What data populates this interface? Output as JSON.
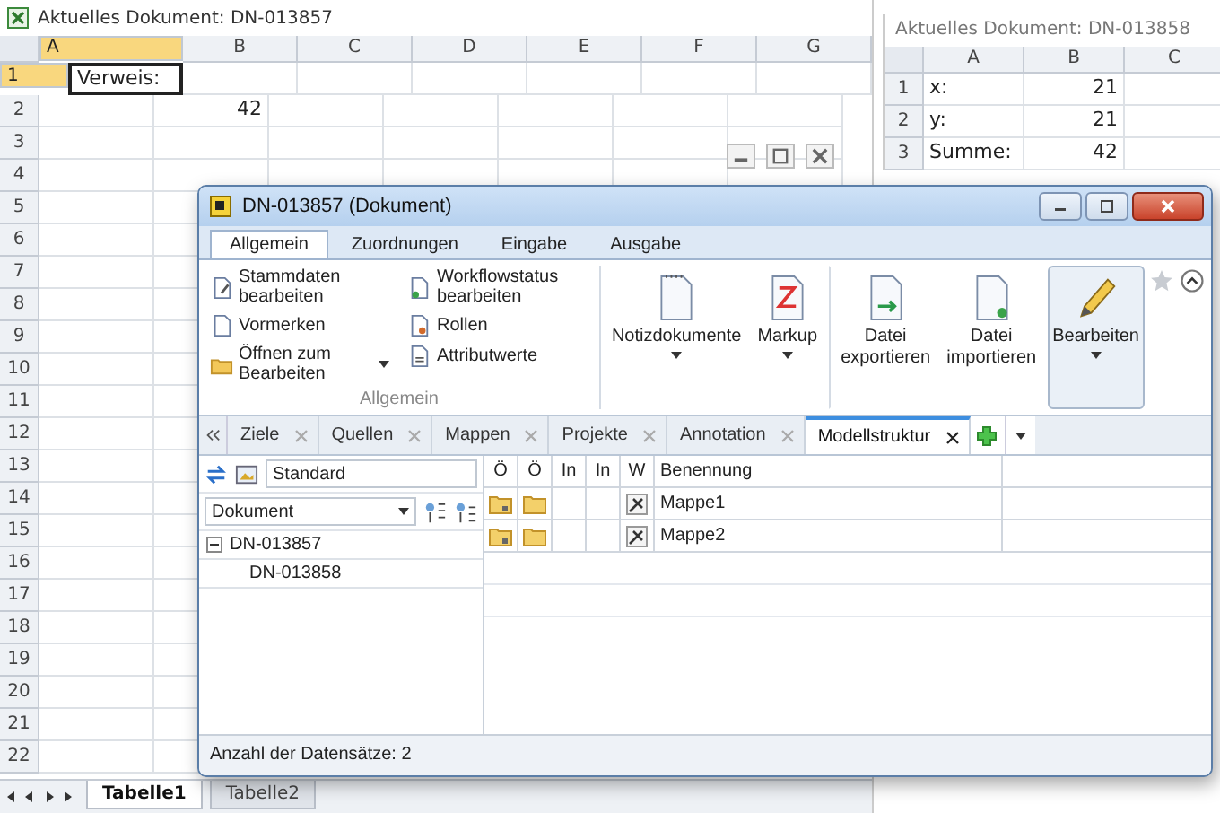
{
  "sheet_main": {
    "title": "Aktuelles Dokument: DN-013857",
    "columns": [
      {
        "label": "A",
        "selected": true
      },
      {
        "label": "B",
        "selected": false
      },
      {
        "label": "C",
        "selected": false
      },
      {
        "label": "D",
        "selected": false
      },
      {
        "label": "E",
        "selected": false
      },
      {
        "label": "F",
        "selected": false
      },
      {
        "label": "G",
        "selected": false
      }
    ],
    "rows": [
      {
        "label": "1",
        "selected": true,
        "cells": [
          {
            "text": "Verweis:",
            "kind": "text"
          }
        ]
      },
      {
        "label": "2",
        "selected": false,
        "cells": [
          null,
          {
            "text": "42",
            "kind": "number"
          }
        ]
      },
      {
        "label": "3",
        "selected": false
      },
      {
        "label": "4",
        "selected": false
      },
      {
        "label": "5",
        "selected": false
      },
      {
        "label": "6",
        "selected": false
      },
      {
        "label": "7",
        "selected": false
      },
      {
        "label": "8",
        "selected": false
      },
      {
        "label": "9",
        "selected": false
      },
      {
        "label": "10",
        "selected": false
      },
      {
        "label": "11",
        "selected": false
      },
      {
        "label": "12",
        "selected": false
      },
      {
        "label": "13",
        "selected": false
      },
      {
        "label": "14",
        "selected": false
      },
      {
        "label": "15",
        "selected": false
      },
      {
        "label": "16",
        "selected": false
      },
      {
        "label": "17",
        "selected": false
      },
      {
        "label": "18",
        "selected": false
      },
      {
        "label": "19",
        "selected": false
      },
      {
        "label": "20",
        "selected": false
      },
      {
        "label": "21",
        "selected": false
      },
      {
        "label": "22",
        "selected": false
      }
    ],
    "sheet_tabs": [
      {
        "label": "Tabelle1",
        "selected": true
      },
      {
        "label": "Tabelle2",
        "selected": false
      }
    ]
  },
  "sheet_side": {
    "title": "Aktuelles Dokument: DN-013858",
    "columns": [
      {
        "label": "A"
      },
      {
        "label": "B"
      },
      {
        "label": "C"
      }
    ],
    "rows": [
      {
        "label": "1",
        "cells": [
          {
            "text": "x:",
            "kind": "text"
          },
          {
            "text": "21",
            "kind": "number"
          }
        ]
      },
      {
        "label": "2",
        "cells": [
          {
            "text": "y:",
            "kind": "text"
          },
          {
            "text": "21",
            "kind": "number"
          }
        ]
      },
      {
        "label": "3",
        "cells": [
          {
            "text": "Summe:",
            "kind": "text"
          },
          {
            "text": "42",
            "kind": "number"
          }
        ]
      }
    ]
  },
  "dialog": {
    "title": "DN-013857 (Dokument)",
    "ribbon_tabs": [
      {
        "label": "Allgemein",
        "selected": true
      },
      {
        "label": "Zuordnungen",
        "selected": false
      },
      {
        "label": "Eingabe",
        "selected": false
      },
      {
        "label": "Ausgabe",
        "selected": false
      }
    ],
    "small_buttons": [
      {
        "label": "Stammdaten bearbeiten",
        "dropdown": false
      },
      {
        "label": "Vormerken",
        "dropdown": false
      },
      {
        "label": "Öffnen zum Bearbeiten",
        "dropdown": true
      },
      {
        "label": "Workflowstatus bearbeiten",
        "dropdown": false
      },
      {
        "label": "Rollen",
        "dropdown": false
      },
      {
        "label": "Attributwerte",
        "dropdown": false
      }
    ],
    "group_label": "Allgemein",
    "large_buttons": [
      {
        "label": "Notizdokumente",
        "dropdown": true,
        "highlighted": false
      },
      {
        "label": "Markup",
        "dropdown": true,
        "highlighted": false
      },
      {
        "label": "Datei exportieren",
        "dropdown": false,
        "highlighted": false
      },
      {
        "label": "Datei importieren",
        "dropdown": false,
        "highlighted": false
      },
      {
        "label": "Bearbeiten",
        "dropdown": true,
        "highlighted": true
      }
    ],
    "panel_tabs": [
      {
        "label": "Ziele",
        "selected": false
      },
      {
        "label": "Quellen",
        "selected": false
      },
      {
        "label": "Mappen",
        "selected": false
      },
      {
        "label": "Projekte",
        "selected": false
      },
      {
        "label": "Annotation",
        "selected": false
      },
      {
        "label": "Modellstruktur",
        "selected": true
      }
    ],
    "view_select": {
      "value": "Standard"
    },
    "column_select": {
      "value": "Dokument"
    },
    "tree": [
      {
        "label": "DN-013857",
        "expanded": true,
        "children": [
          {
            "label": "DN-013858"
          }
        ]
      }
    ],
    "grid": {
      "columns": [
        {
          "label": "Ö"
        },
        {
          "label": "Ö"
        },
        {
          "label": "In"
        },
        {
          "label": "In"
        },
        {
          "label": "W"
        },
        {
          "label": "Benennung"
        }
      ],
      "rows": [
        {
          "name": "Mappe1"
        },
        {
          "name": "Mappe2"
        }
      ]
    },
    "status": "Anzahl der Datensätze: 2"
  }
}
